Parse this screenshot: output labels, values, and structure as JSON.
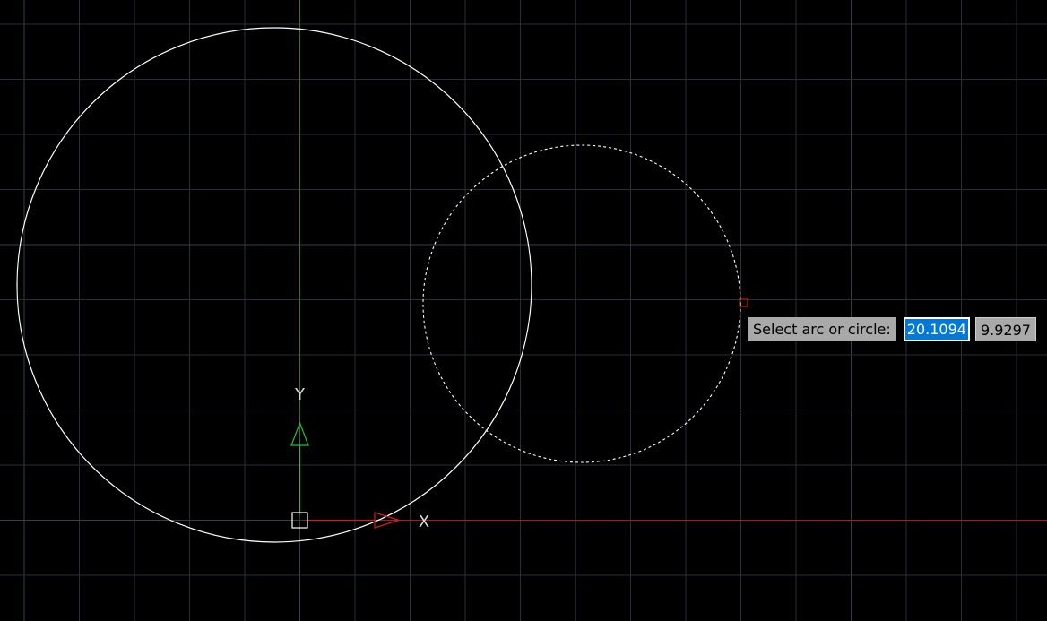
{
  "canvas": {
    "background": "#000000",
    "grid_color": "#2a2f33",
    "grid_major_color": "#3a3f44",
    "x_axis_color": "#b31818",
    "y_axis_color": "#1f7a2e"
  },
  "ucs_icon": {
    "x_label": "X",
    "y_label": "Y",
    "x_color": "#d21e1e",
    "y_color": "#2bbd3a",
    "origin_color": "#ffffff"
  },
  "entities": {
    "circle_color": "#ffffff",
    "preview_circle_color": "#ffffff",
    "cursor_marker_color": "#e02020"
  },
  "dynamic_input": {
    "prompt": "Select arc or circle:",
    "x_value": "20.1094",
    "y_value": "9.9297"
  }
}
